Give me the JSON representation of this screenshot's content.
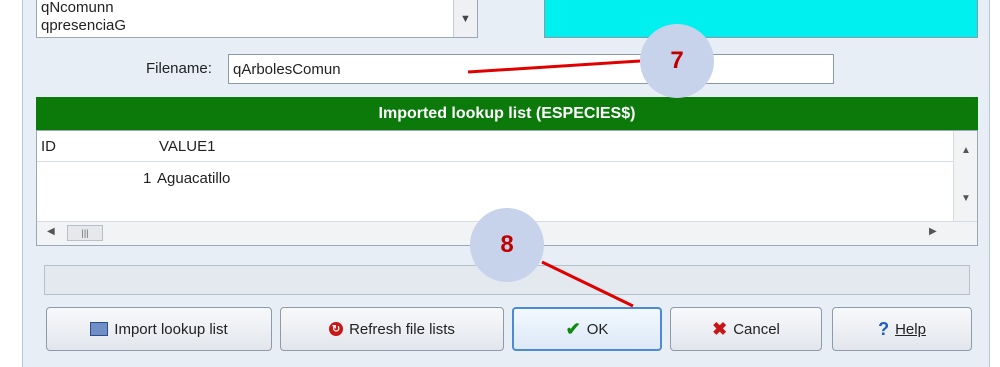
{
  "query_list": {
    "items": [
      "qNcomunn",
      "qpresenciaG"
    ]
  },
  "filename": {
    "label": "Filename:",
    "value": "qArbolesComun"
  },
  "header_bar": {
    "title": "Imported lookup list (ESPECIES$)"
  },
  "grid": {
    "columns": [
      "ID",
      "VALUE1"
    ],
    "rows": [
      {
        "id": "1",
        "value": "Aguacatillo"
      }
    ]
  },
  "buttons": {
    "import": "Import lookup list",
    "refresh": "Refresh file lists",
    "ok": "OK",
    "cancel": "Cancel",
    "help": "Help"
  },
  "callouts": {
    "seven": "7",
    "eight": "8"
  },
  "colors": {
    "header_green": "#0b7a0b",
    "cyan_panel": "#00f0f0",
    "annotation_red": "#e00000"
  }
}
